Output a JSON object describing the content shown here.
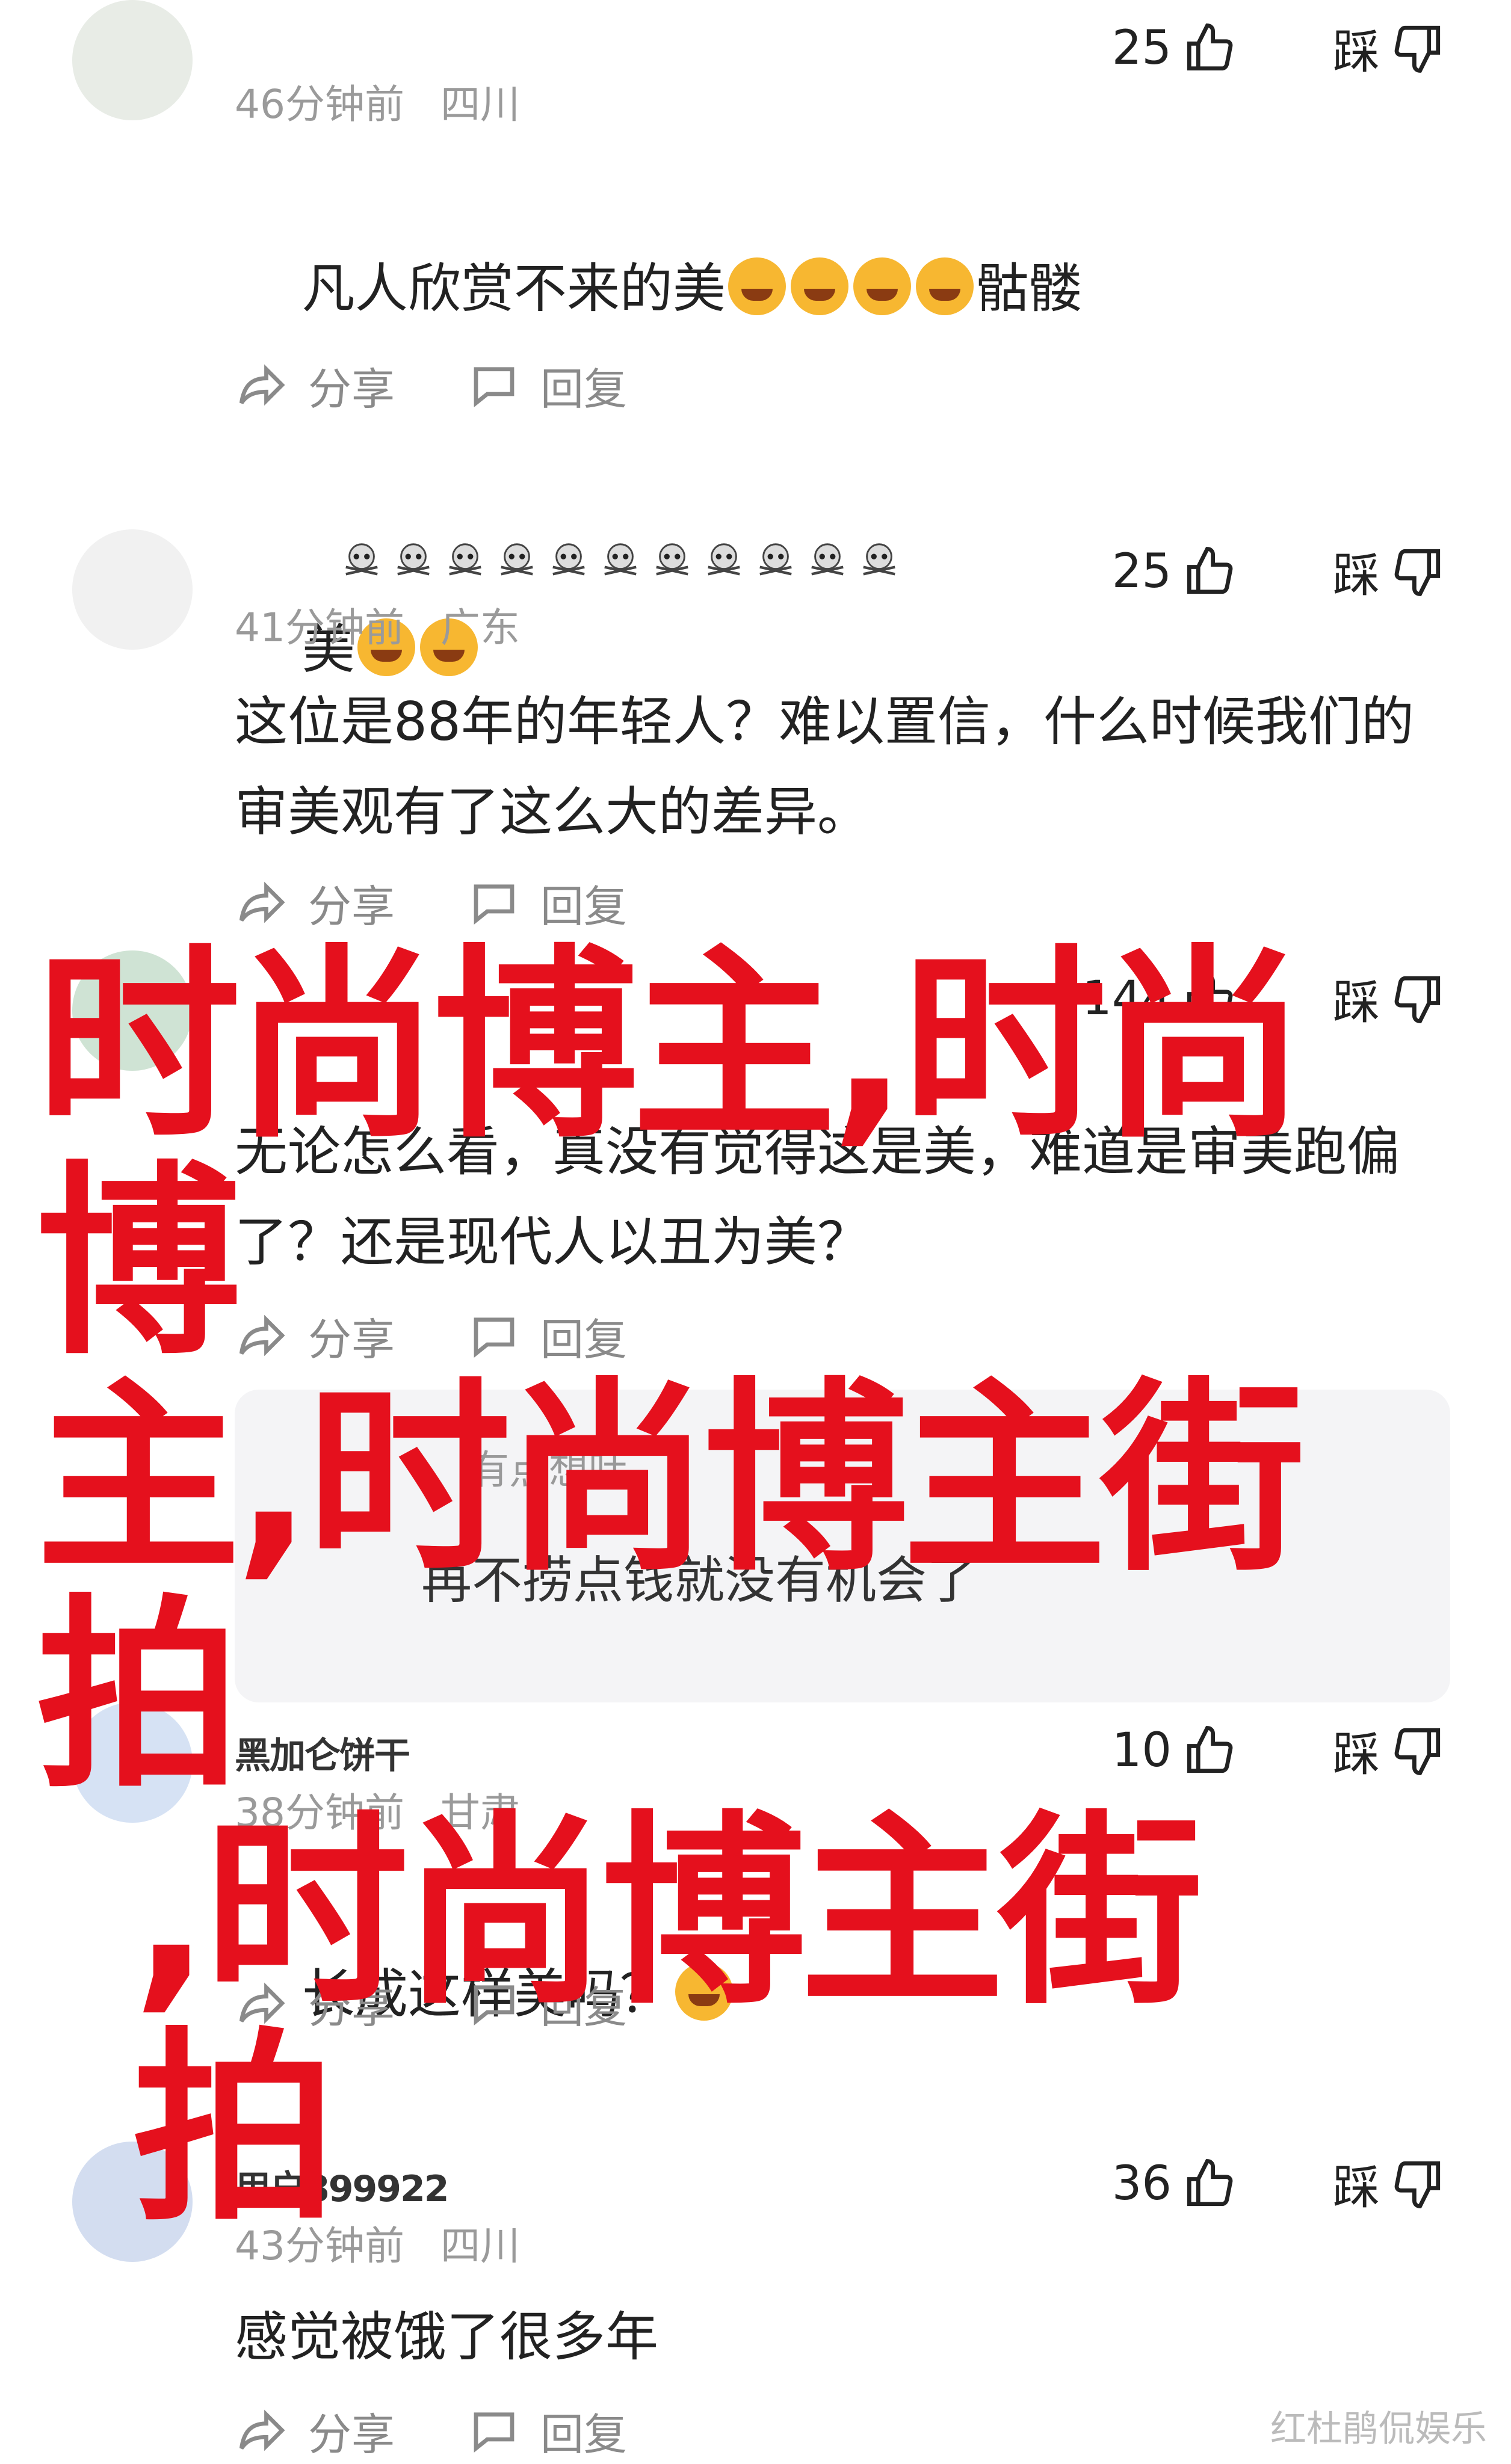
{
  "comments": [
    {
      "time": "46分钟前",
      "location": "四川",
      "text_line1": "凡人欣赏不来的美",
      "text_line1_tail": "骷髅",
      "text_line2_tail": "美",
      "likes": "25",
      "dislike_label": "踩",
      "share_label": "分享",
      "reply_label": "回复"
    },
    {
      "time": "41分钟前",
      "location": "广东",
      "text": "这位是88年的年轻人？难以置信，什么时候我们的审美观有了这么大的差异。",
      "likes": "25",
      "dislike_label": "踩",
      "share_label": "分享",
      "reply_label": "回复"
    },
    {
      "time": "",
      "location": "",
      "text": "无论怎么看，真没有觉得这是美，难道是审美跑偏了？还是现代人以丑为美？",
      "likes": "144",
      "dislike_label": "踩",
      "share_label": "分享",
      "reply_label": "回复",
      "quote_name": "有点想吐",
      "quote_text": "再不捞点钱就没有机会了"
    },
    {
      "username": "黑加仑饼干",
      "time": "38分钟前",
      "location": "甘肃",
      "text": "长成这样美吗？",
      "likes": "10",
      "dislike_label": "踩",
      "share_label": "分享",
      "reply_label": "回复"
    },
    {
      "username": "用户899922",
      "time": "43分钟前",
      "location": "四川",
      "text": "感觉被饿了很多年",
      "likes": "36",
      "dislike_label": "踩",
      "share_label": "分享",
      "reply_label": "回复"
    }
  ],
  "overlay": {
    "line1": "时尚博主,时尚博",
    "line2": "主,时尚博主街拍",
    "line3": ",时尚博主街拍"
  },
  "watermark": "红杜鹃侃娱乐",
  "colors": {
    "overlay_red": "#e5101d",
    "meta_gray": "#9a9a9a"
  }
}
